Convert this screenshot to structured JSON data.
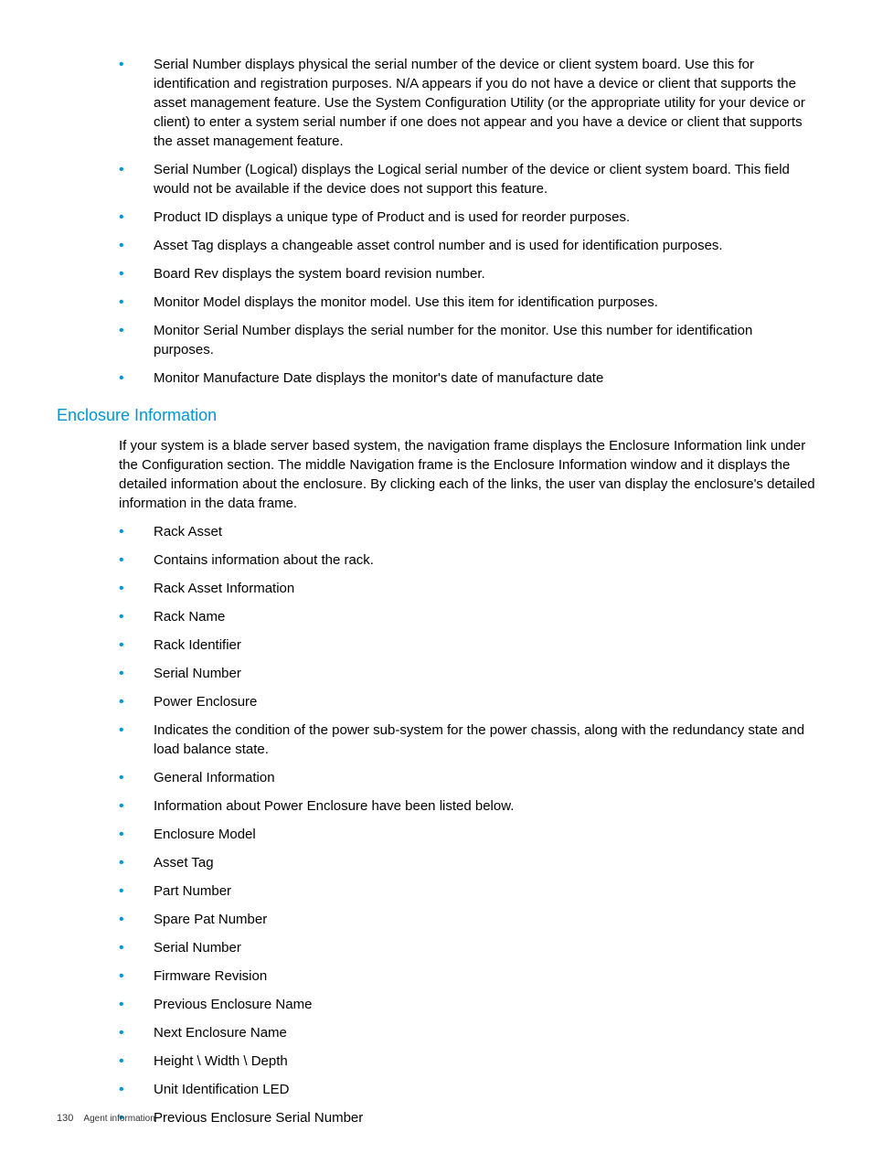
{
  "top_list": [
    "Serial Number displays physical the serial number of the device or client system board. Use this for identification and registration purposes. N/A appears if you do not have a device or client that supports the asset management feature. Use the System Configuration Utility (or the appropriate utility for your device or client) to enter a system serial number if one does not appear and you have a device or client that supports the asset management feature.",
    "Serial Number (Logical) displays the Logical serial number of the device or client system board. This field would not be available if the device does not support this feature.",
    "Product ID displays a unique type of Product and is used for reorder purposes.",
    "Asset Tag displays a changeable asset control number and is used for identification purposes.",
    "Board Rev displays the system board revision number.",
    "Monitor Model displays the monitor model. Use this item for identification purposes.",
    "Monitor Serial Number displays the serial number for the monitor. Use this number for identification purposes.",
    "Monitor Manufacture Date displays the monitor's date of manufacture date"
  ],
  "section": {
    "heading": "Enclosure Information",
    "intro": "If your system is a blade server based system, the navigation frame displays the Enclosure Information link under the Configuration section. The middle Navigation frame is the Enclosure Information window and it displays the detailed information about the enclosure. By clicking each of the links, the user van display the enclosure's detailed information in the data frame.",
    "items": [
      "Rack Asset",
      "Contains information about the rack.",
      "Rack Asset Information",
      "Rack Name",
      "Rack Identifier",
      "Serial Number",
      "Power Enclosure",
      "Indicates the condition of the power sub-system for the power chassis, along with the redundancy state and load balance state.",
      "General Information",
      "Information about Power Enclosure have been listed below.",
      "Enclosure Model",
      "Asset Tag",
      "Part Number",
      "Spare Pat Number",
      "Serial Number",
      "Firmware Revision",
      "Previous Enclosure Name",
      "Next Enclosure Name",
      "Height \\ Width \\ Depth",
      "Unit Identification LED",
      "Previous Enclosure Serial Number"
    ]
  },
  "footer": {
    "page_num": "130",
    "label": "Agent information"
  }
}
